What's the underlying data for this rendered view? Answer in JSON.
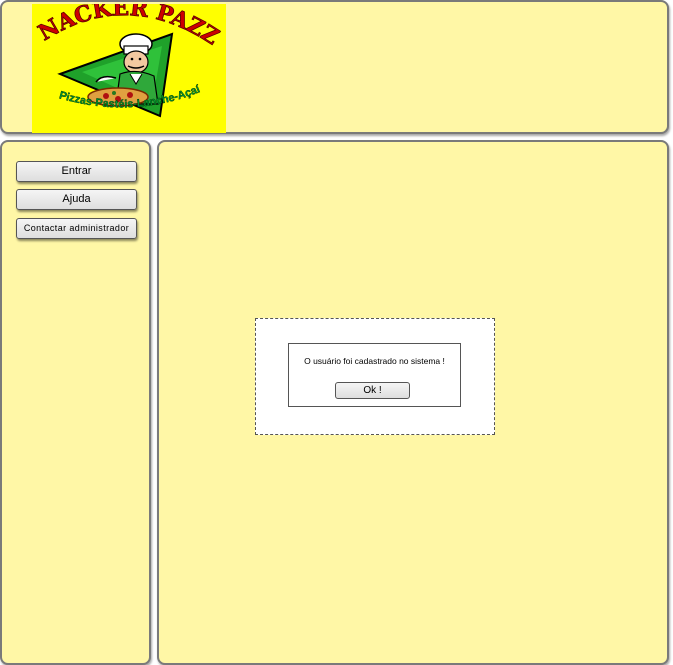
{
  "header": {
    "logo": {
      "title": "SNACKER PAZZA",
      "tagline": "Pizzas-Pastéis-Lanche-Açaí",
      "colors": {
        "background": "#ffff00",
        "title": "#cc0000",
        "tagline": "#009933",
        "triangle": "#1fa12a"
      }
    }
  },
  "sidebar": {
    "buttons": [
      {
        "label": "Entrar"
      },
      {
        "label": "Ajuda"
      },
      {
        "label": "Contactar administrador"
      }
    ]
  },
  "dialog": {
    "message": "O usuário foi cadastrado no sistema !",
    "ok_label": "Ok !"
  },
  "colors": {
    "panel_background": "#fff7a6",
    "panel_border": "#7a7a7a"
  }
}
